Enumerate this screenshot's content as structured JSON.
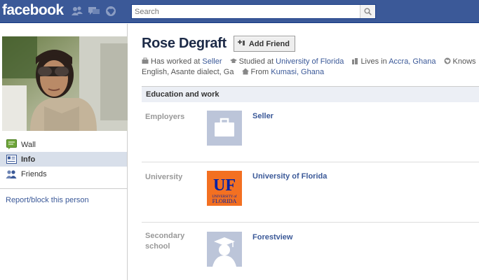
{
  "topbar": {
    "logo": "facebook",
    "search_placeholder": "Search",
    "jewels": [
      "friend-requests-icon",
      "messages-icon",
      "notifications-icon"
    ]
  },
  "nav": {
    "items": [
      {
        "label": "Wall",
        "icon": "wall-icon"
      },
      {
        "label": "Info",
        "icon": "info-icon",
        "active": true
      },
      {
        "label": "Friends",
        "icon": "friends-icon"
      }
    ],
    "report_link": "Report/block this person"
  },
  "profile": {
    "name": "Rose Degraft",
    "add_friend_label": "Add Friend",
    "bio": {
      "worked_prefix": "Has worked at",
      "worked_link": "Seller",
      "studied_prefix": "Studied at",
      "studied_link": "University of Florida",
      "lives_prefix": "Lives in",
      "lives_link": "Accra, Ghana",
      "knows_prefix": "Knows",
      "knows_text": "English, Asante dialect, Ga",
      "from_prefix": "From",
      "from_link": "Kumasi, Ghana"
    }
  },
  "section": {
    "title": "Education and work",
    "rows": [
      {
        "label": "Employers",
        "link": "Seller",
        "thumb": "briefcase-icon"
      },
      {
        "label": "University",
        "link": "University of Florida",
        "thumb": "uf-logo"
      },
      {
        "label": "Secondary school",
        "link": "Forestview",
        "thumb": "graduate-icon"
      }
    ]
  },
  "colors": {
    "brand_blue": "#3b5998",
    "header_bg": "#eceff5",
    "active_nav_bg": "#d8dfea",
    "uf_orange": "#f37021",
    "uf_blue": "#0021a5"
  }
}
